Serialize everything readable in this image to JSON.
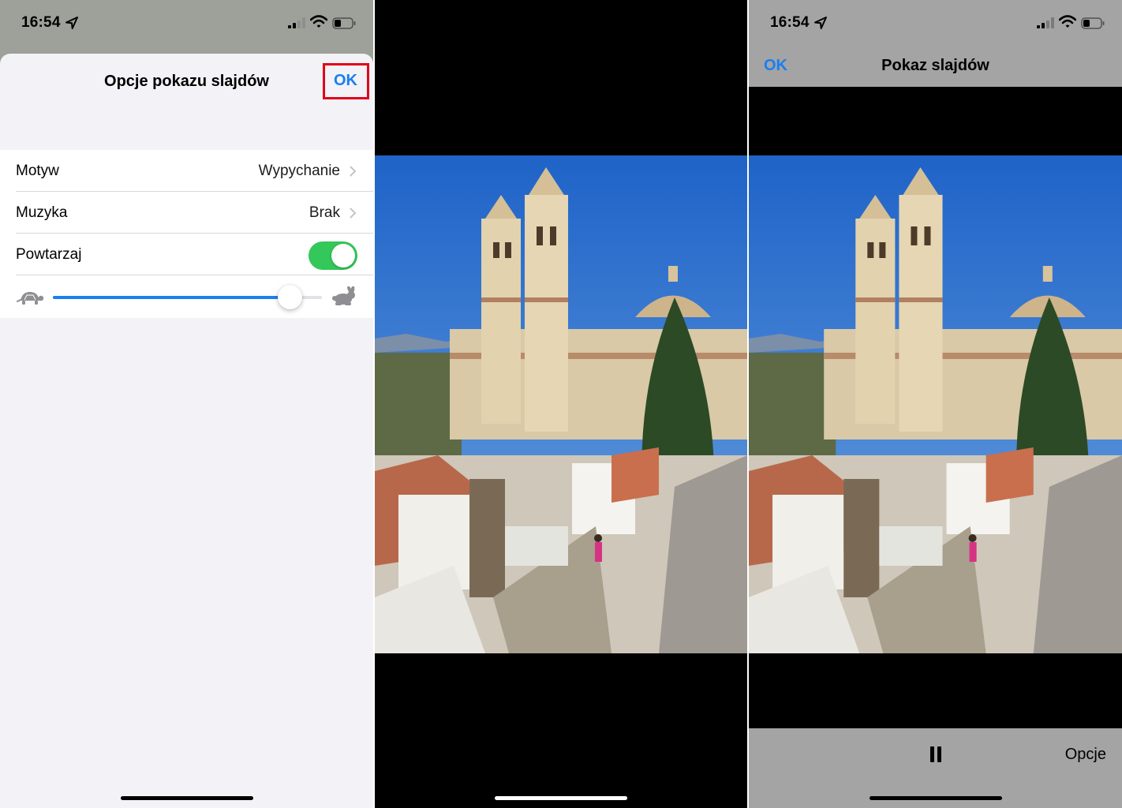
{
  "panel1": {
    "status": {
      "time": "16:54"
    },
    "sheet": {
      "title": "Opcje pokazu slajdów",
      "ok_label": "OK"
    },
    "settings": [
      {
        "label": "Motyw",
        "value": "Wypychanie"
      },
      {
        "label": "Muzyka",
        "value": "Brak"
      },
      {
        "label": "Powtarzaj",
        "toggle_on": true
      }
    ],
    "speed_slider": {
      "value_fraction": 0.88,
      "min_icon": "turtle-icon",
      "max_icon": "rabbit-icon"
    }
  },
  "panel2": {
    "photo_icon": "church-photo"
  },
  "panel3": {
    "status": {
      "time": "16:54"
    },
    "nav": {
      "ok_label": "OK",
      "title": "Pokaz slajdów"
    },
    "toolbar": {
      "pause_icon": "pause-icon",
      "options_label": "Opcje"
    }
  },
  "colors": {
    "accent": "#1a7ff0",
    "toggle_on": "#34c759",
    "highlight": "#e0001a"
  }
}
